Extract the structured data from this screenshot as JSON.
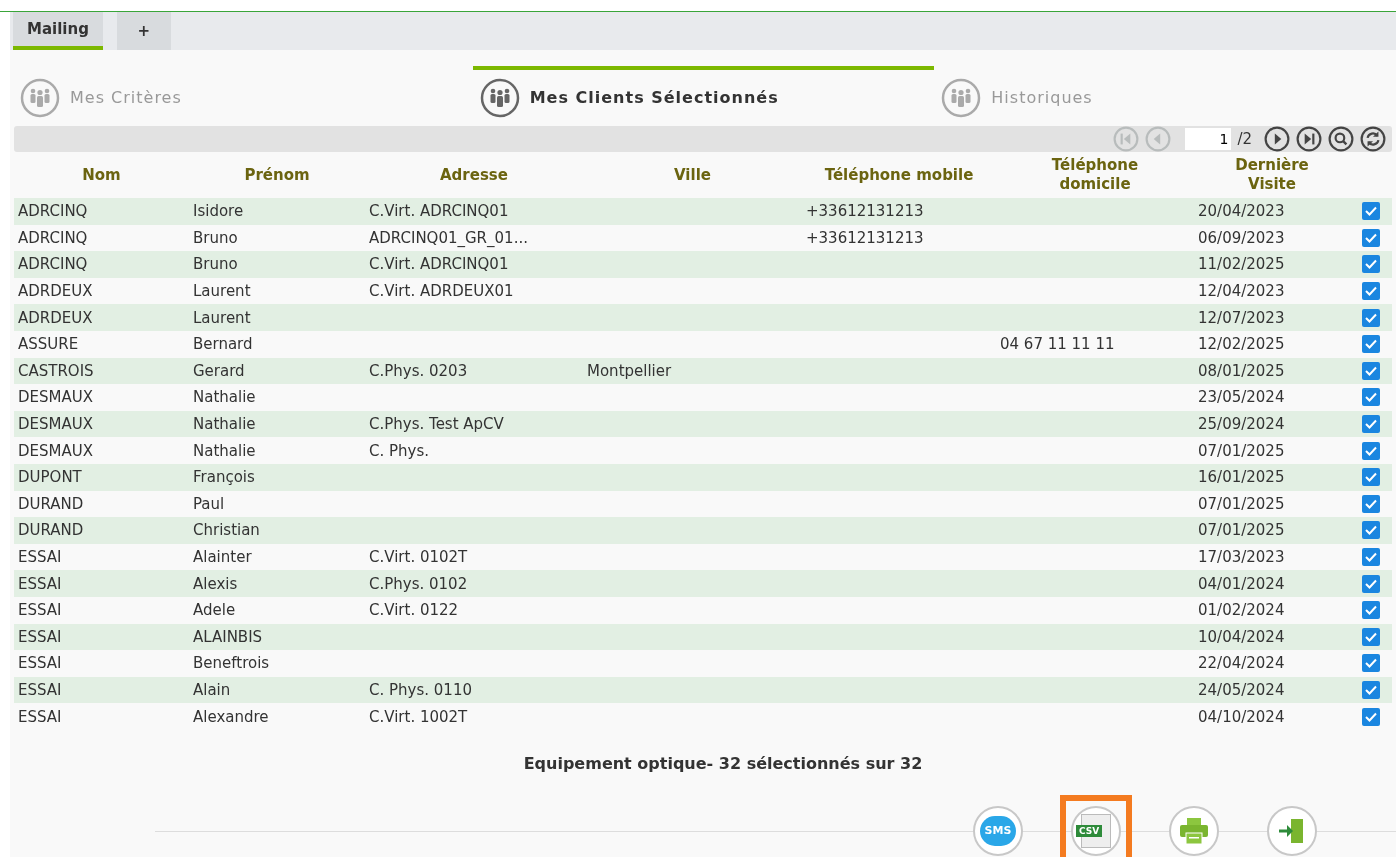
{
  "tabs": [
    {
      "label": "Mailing",
      "selected": true
    },
    {
      "label": "+",
      "selected": false
    }
  ],
  "steps": [
    {
      "label": "Mes Critères",
      "selected": false
    },
    {
      "label": "Mes Clients Sélectionnés",
      "selected": true
    },
    {
      "label": "Historiques",
      "selected": false
    }
  ],
  "pager": {
    "first_disabled": true,
    "prev_disabled": true,
    "page": "1",
    "total": "/2"
  },
  "table": {
    "columns": [
      "Nom",
      "Prénom",
      "Adresse",
      "Ville",
      "Téléphone mobile",
      "Téléphone domicile",
      "Dernière Visite"
    ],
    "rows": [
      {
        "nom": "ADRCINQ",
        "prenom": "Isidore",
        "adresse": "C.Virt. ADRCINQ01",
        "mobile": "+33612131213",
        "visite": "20/04/2023",
        "checked": true
      },
      {
        "nom": "ADRCINQ",
        "prenom": "Bruno",
        "adresse": "ADRCINQ01_GR_01...",
        "mobile": "+33612131213",
        "visite": "06/09/2023",
        "checked": true
      },
      {
        "nom": "ADRCINQ",
        "prenom": "Bruno",
        "adresse": "C.Virt. ADRCINQ01",
        "visite": "11/02/2025",
        "checked": true
      },
      {
        "nom": "ADRDEUX",
        "prenom": "Laurent",
        "adresse": "C.Virt. ADRDEUX01",
        "visite": "12/04/2023",
        "checked": true
      },
      {
        "nom": "ADRDEUX",
        "prenom": "Laurent",
        "visite": "12/07/2023",
        "checked": true
      },
      {
        "nom": "ASSURE",
        "prenom": "Bernard",
        "domicile": "04 67 11 11 11",
        "visite": "12/02/2025",
        "checked": true
      },
      {
        "nom": "CASTROIS",
        "prenom": "Gerard",
        "adresse": "C.Phys. 0203",
        "ville": "Montpellier",
        "visite": "08/01/2025",
        "checked": true
      },
      {
        "nom": "DESMAUX",
        "prenom": "Nathalie",
        "visite": "23/05/2024",
        "checked": true
      },
      {
        "nom": "DESMAUX",
        "prenom": "Nathalie",
        "adresse": "C.Phys. Test ApCV",
        "visite": "25/09/2024",
        "checked": true
      },
      {
        "nom": "DESMAUX",
        "prenom": "Nathalie",
        "adresse": "C. Phys.",
        "visite": "07/01/2025",
        "checked": true
      },
      {
        "nom": "DUPONT",
        "prenom": "François",
        "visite": "16/01/2025",
        "checked": true
      },
      {
        "nom": "DURAND",
        "prenom": "Paul",
        "visite": "07/01/2025",
        "checked": true
      },
      {
        "nom": "DURAND",
        "prenom": "Christian",
        "visite": "07/01/2025",
        "checked": true
      },
      {
        "nom": "ESSAI",
        "prenom": "Alainter",
        "adresse": "C.Virt. 0102T",
        "visite": "17/03/2023",
        "checked": true
      },
      {
        "nom": "ESSAI",
        "prenom": "Alexis",
        "adresse": "C.Phys. 0102",
        "visite": "04/01/2024",
        "checked": true
      },
      {
        "nom": "ESSAI",
        "prenom": "Adele",
        "adresse": "C.Virt. 0122",
        "visite": "01/02/2024",
        "checked": true
      },
      {
        "nom": "ESSAI",
        "prenom": "ALAINBIS",
        "visite": "10/04/2024",
        "checked": true
      },
      {
        "nom": "ESSAI",
        "prenom": "Beneftrois",
        "visite": "22/04/2024",
        "checked": true
      },
      {
        "nom": "ESSAI",
        "prenom": "Alain",
        "adresse": "C. Phys. 0110",
        "visite": "24/05/2024",
        "checked": true
      },
      {
        "nom": "ESSAI",
        "prenom": "Alexandre",
        "adresse": "C.Virt. 1002T",
        "visite": "04/10/2024",
        "checked": true
      }
    ]
  },
  "summary": "Equipement optique- 32 sélectionnés sur 32",
  "actions": [
    {
      "kind": "sms",
      "label": "SMS",
      "highlighted": false
    },
    {
      "kind": "csv",
      "label": "CSV",
      "highlighted": true
    },
    {
      "kind": "print",
      "highlighted": false
    },
    {
      "kind": "exit",
      "highlighted": false
    }
  ]
}
